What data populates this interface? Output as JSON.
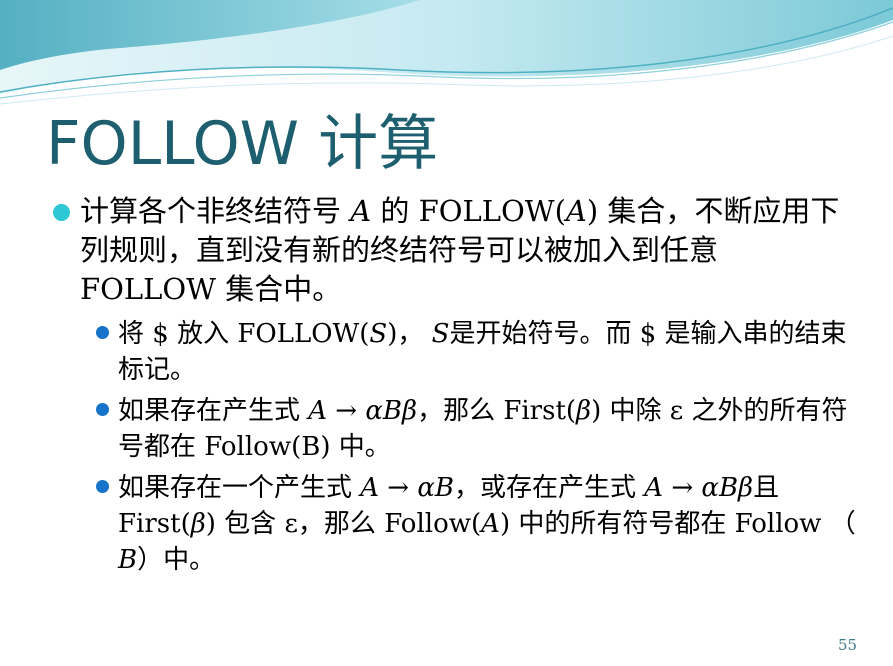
{
  "title": "FOLLOW 计算",
  "bullet1": {
    "t1": "计算各个非终结符号 ",
    "a": "A",
    "t2": " 的 ",
    "follow_open": "FOLLOW(",
    "a2": "A",
    "close": ")",
    "t3": " 集合，不断应用下列规则，直到没有新的终结符号可以被加入到任意 ",
    "follow_word": "FOLLOW",
    "t4": " 集合中。"
  },
  "rule1": {
    "t1": "将 ",
    "dollar": "$",
    "t2": " 放入 ",
    "follow_open": "FOLLOW(",
    "s": "S",
    "close": ")",
    "t3": "，  ",
    "s2": "S",
    "t4": "是开始符号。而 ",
    "dollar2": "$",
    "t5": " 是输入串的结束标记。"
  },
  "rule2": {
    "t1": "如果存在产生式 ",
    "production": "A → αBβ",
    "t2": "，那么 ",
    "first_open": "First(",
    "beta": "β",
    "close": ")",
    "t3": " 中除 ",
    "epsilon": "ε",
    "t4": " 之外的所有符号都在 ",
    "follow_b": "Follow(B)",
    "t5": " 中。"
  },
  "rule3": {
    "t1": "如果存在一个产生式 ",
    "production1": "A → αB",
    "t2": "，或存在产生式 ",
    "production2": "A → αBβ",
    "t3": "且 ",
    "first_open": "First(",
    "beta": "β",
    "close": ")",
    "t4": " 包含 ",
    "epsilon": "ε",
    "t5": "，那么 ",
    "follow_open": "Follow(",
    "a": "A",
    "close2": ")",
    "t6": " 中的所有符号都在 ",
    "follow_word": "Follow",
    "t7": " （ ",
    "b": "B",
    "t8": "）中。"
  },
  "page_number": "55",
  "colors": {
    "title": "#1d5f6e",
    "bullet_level1": "#2ec7d4",
    "bullet_level2": "#1673c9",
    "wave_dark": "#5fb7c6",
    "wave_light": "#bfe6ee"
  }
}
